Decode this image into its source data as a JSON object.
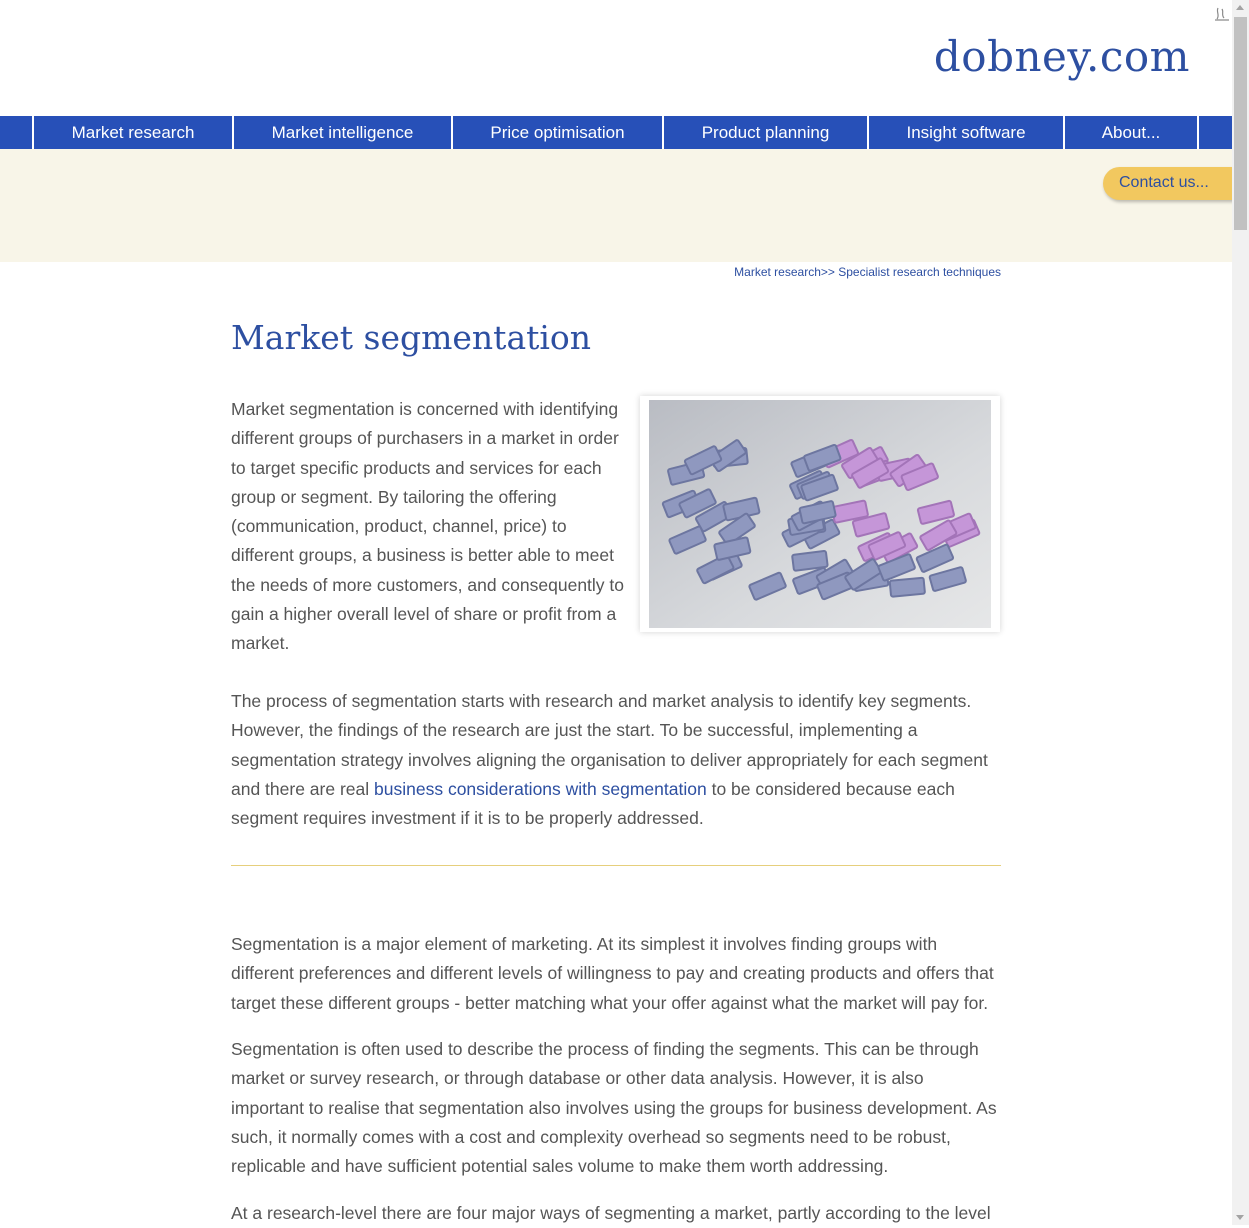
{
  "header": {
    "logo": "dobney.com",
    "corner_icon": "accessibility-icon"
  },
  "nav": {
    "items": [
      {
        "label": "Market research"
      },
      {
        "label": "Market intelligence"
      },
      {
        "label": "Price optimisation"
      },
      {
        "label": "Product planning"
      },
      {
        "label": "Insight software"
      },
      {
        "label": "About..."
      }
    ],
    "bar_color": "#2750b8"
  },
  "banner": {
    "contact_label": "Contact us...",
    "background": "#f8f5e8",
    "button_color": "#f2c85f"
  },
  "breadcrumb": {
    "part1": "Market research",
    "sep": ">>",
    "part2": "Specialist research techniques"
  },
  "main": {
    "title": "Market segmentation",
    "intro": "Market segmentation is concerned with identifying different groups of purchasers in a market in order to target specific products and services for each group or segment. By tailoring the offering (communication, product, channel, price) to different groups, a business is better able to meet the needs of more customers, and consequently to gain a higher overall level of share or profit from a market.",
    "p2_before": "The process of segmentation starts with research and market analysis to identify key segments. However, the findings of the research are just the start. To be successful, implementing a segmentation strategy involves aligning the organisation to deliver appropriately for each segment and there are real ",
    "p2_link": "business considerations with segmentation",
    "p2_after": " to be considered because each segment requires investment if it is to be properly addressed.",
    "p3": "Segmentation is a major element of marketing. At its simplest it involves finding groups with different preferences and different levels of willingness to pay and creating products and offers that target these different groups - better matching what your offer against what the market will pay for.",
    "p4": "Segmentation is often used to describe the process of finding the segments. This can be through market or survey research, or through database or other data analysis. However, it is also important to realise that segmentation also involves using the groups for business development. As such, it normally comes with a cost and complexity overhead so segments need to be robust, replicable and have sufficient potential sales volume to make them worth addressing.",
    "p5": "At a research-level there are four major ways of segmenting a market, partly according to the level"
  },
  "colors": {
    "link": "#2d4fa1",
    "text": "#555555",
    "rule": "#e6cf7c"
  }
}
